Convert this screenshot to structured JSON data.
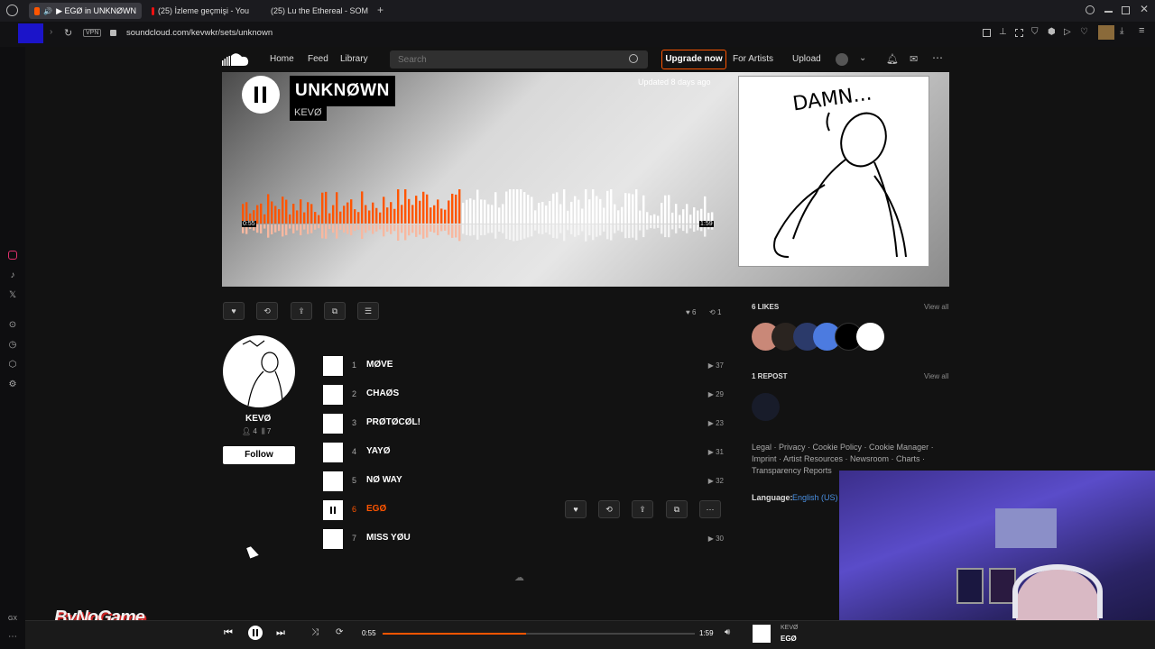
{
  "browser": {
    "tabs": [
      {
        "label": "▶ EGØ in UNKNØWN",
        "active": true
      },
      {
        "label": "(25) İzleme geçmişi - You",
        "active": false
      },
      {
        "label": "(25) Lu the Ethereal - SOM",
        "active": false
      }
    ],
    "new_tab": "+",
    "vpn": "VPN",
    "url": "soundcloud.com/kevwkr/sets/unknown"
  },
  "nav": {
    "home": "Home",
    "feed": "Feed",
    "library": "Library",
    "search_placeholder": "Search",
    "upgrade": "Upgrade now",
    "for_artists": "For Artists",
    "upload": "Upload"
  },
  "hero": {
    "title": "UNKNØWN",
    "artist": "KEVØ",
    "updated": "Updated 8 days ago",
    "time_current": "0:55",
    "time_total": "1:59",
    "progress": 0.46,
    "art_text": "DAMN..."
  },
  "stats": {
    "likes": "6",
    "reposts": "1"
  },
  "artist": {
    "name": "KEVØ",
    "followers": "4",
    "tracks": "7",
    "follow": "Follow"
  },
  "tracks": [
    {
      "num": "1",
      "name": "MØVE",
      "plays": "37"
    },
    {
      "num": "2",
      "name": "CHAØS",
      "plays": "29"
    },
    {
      "num": "3",
      "name": "PRØTØCØL!",
      "plays": "23"
    },
    {
      "num": "4",
      "name": "YAYØ",
      "plays": "31"
    },
    {
      "num": "5",
      "name": "NØ WAY",
      "plays": "32"
    },
    {
      "num": "6",
      "name": "EGØ",
      "plays": "",
      "active": true
    },
    {
      "num": "7",
      "name": "MISS YØU",
      "plays": "30"
    }
  ],
  "sidebar_right": {
    "likes_heading": "6 LIKES",
    "likes_view_all": "View all",
    "repost_heading": "1 REPOST",
    "repost_view_all": "View all",
    "footer_line1": "Legal · Privacy · Cookie Policy · Cookie Manager ·",
    "footer_line2": "Imprint · Artist Resources · Newsroom · Charts ·",
    "footer_line3": "Transparency Reports",
    "language_label": "Language:",
    "language_value": "English (US)"
  },
  "player": {
    "time_current": "0:55",
    "time_total": "1:59",
    "progress": 0.46,
    "artist": "KEVØ",
    "track": "EGØ"
  },
  "watermark": "ByNoGame",
  "colors": {
    "accent": "#ff5500",
    "bg": "#121212",
    "link": "#4a90e2"
  }
}
